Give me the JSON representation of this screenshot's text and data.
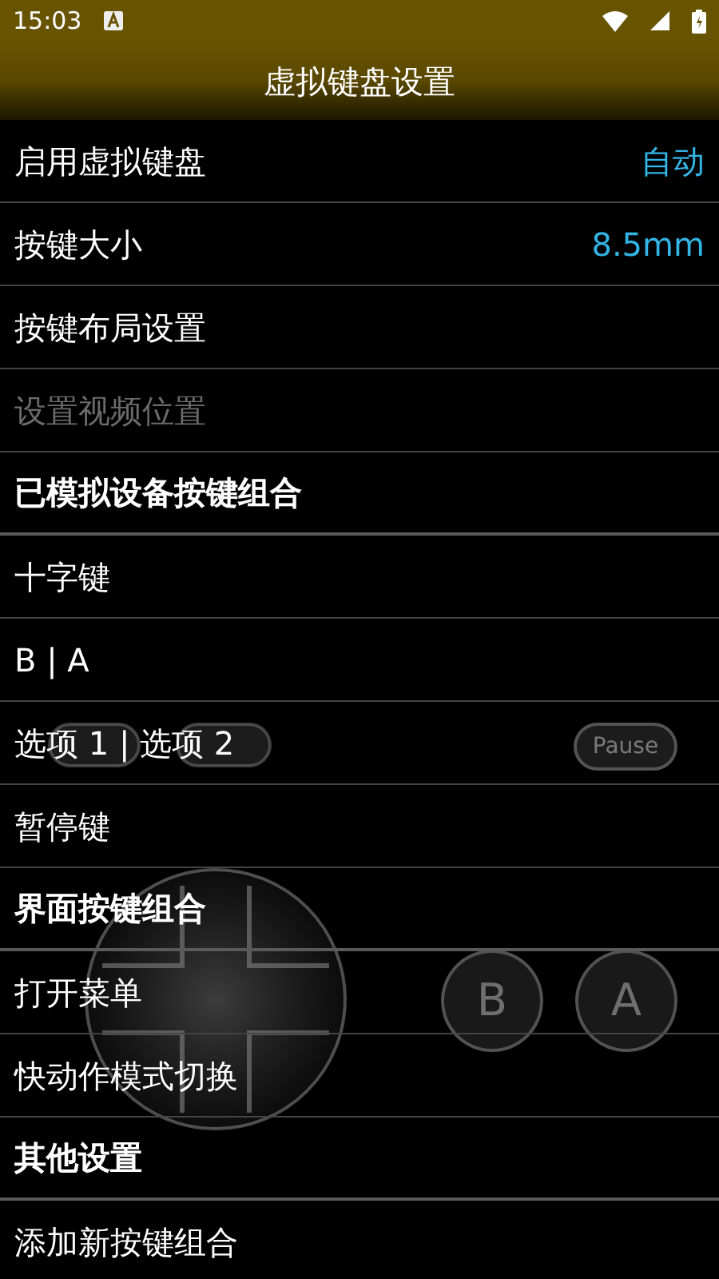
{
  "status_bar": {
    "time": "15:03"
  },
  "title": "虚拟键盘设置",
  "rows": [
    {
      "kind": "item",
      "label": "启用虚拟键盘",
      "value": "自动",
      "disabled": false
    },
    {
      "kind": "item",
      "label": "按键大小",
      "value": "8.5mm",
      "disabled": false
    },
    {
      "kind": "item",
      "label": "按键布局设置",
      "disabled": false
    },
    {
      "kind": "item",
      "label": "设置视频位置",
      "disabled": true
    },
    {
      "kind": "header",
      "label": "已模拟设备按键组合"
    },
    {
      "kind": "item",
      "label": "十字键",
      "disabled": false
    },
    {
      "kind": "item",
      "label": "B | A",
      "disabled": false
    },
    {
      "kind": "item",
      "label": "选项 1 | 选项 2",
      "disabled": false
    },
    {
      "kind": "item",
      "label": "暂停键",
      "disabled": false
    },
    {
      "kind": "header",
      "label": "界面按键组合"
    },
    {
      "kind": "item",
      "label": "打开菜单",
      "disabled": false
    },
    {
      "kind": "item",
      "label": "快动作模式切换",
      "disabled": false
    },
    {
      "kind": "header",
      "label": "其他设置"
    },
    {
      "kind": "item",
      "label": "添加新按键组合",
      "disabled": false
    }
  ],
  "overlay": {
    "pause_label": "Pause",
    "b_label": "B",
    "a_label": "A"
  }
}
